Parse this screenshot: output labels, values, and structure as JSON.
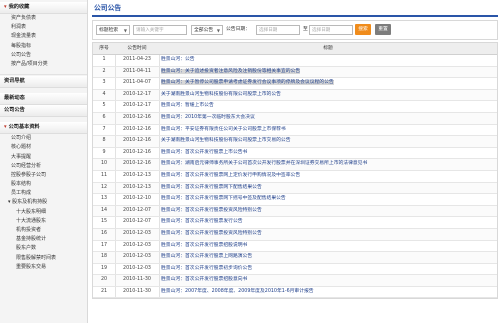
{
  "sidebar": {
    "fav_title": "我的收藏",
    "fav_items": [
      "资产负债表",
      "利润表",
      "现金流量表",
      "每股指标",
      "公司公告",
      "按产品/项目分类"
    ],
    "nav_title": "资讯导航",
    "news_title": "最新动态",
    "notice_title": "公司公告",
    "profile_title": "公司基本资料",
    "profile_items": [
      "公司介绍",
      "核心题材",
      "大事提醒",
      "公司经营分析",
      "控股参股子公司",
      "股本结构",
      "员工构成"
    ],
    "holders_title": "股东及机构持股",
    "holders_items": [
      "十大股东明细",
      "十大流通股东",
      "机构投资者",
      "基金持股统计",
      "股东户数",
      "限售股解禁时间表",
      "重要股东交易"
    ]
  },
  "header": {
    "title": "公司公告"
  },
  "search": {
    "type_select": "标题检索",
    "keyword_placeholder": "请输入关键字",
    "category_select": "全部公告",
    "date_label": "公告日期：",
    "start_placeholder": "选择日期",
    "to_label": "至",
    "end_placeholder": "选择日期",
    "search_label": "搜索",
    "reset_label": "重置"
  },
  "table": {
    "col_index": "序号",
    "col_date": "公告时间",
    "col_title": "标题",
    "rows": [
      {
        "index": "1",
        "date": "2011-04-23",
        "title": "胜景山河：公告"
      },
      {
        "index": "2",
        "date": "2011-04-11",
        "title": "胜景山河：关于追述投资者注意风险及注销股份等相关事宜的公告"
      },
      {
        "index": "3",
        "date": "2011-04-07",
        "title": "胜景山河：关于暂停公司股票申请考虑证券发行会议事项的停牌及会议议程的公告"
      },
      {
        "index": "4",
        "date": "2010-12-17",
        "title": "关于湖南胜景山河生物科技股份有限公司股票上市的公告"
      },
      {
        "index": "5",
        "date": "2010-12-17",
        "title": "胜景山河：暂缓上市公告"
      },
      {
        "index": "6",
        "date": "2010-12-16",
        "title": "胜景山河：2010年第一次临时股东大会决议"
      },
      {
        "index": "7",
        "date": "2010-12-16",
        "title": "胜景山河：平安证券有限责任公司关于公司股票上市保荐书"
      },
      {
        "index": "8",
        "date": "2010-12-16",
        "title": "关于湖南胜景山河生物科技股份有限公司股票上市交易的公告"
      },
      {
        "index": "9",
        "date": "2010-12-16",
        "title": "胜景山河：首次公开发行股票上市公告书"
      },
      {
        "index": "10",
        "date": "2010-12-16",
        "title": "胜景山河：湖南启元律师事务所关于公司首次公开发行股票并在深圳证券交易所上市的法律意见书"
      },
      {
        "index": "11",
        "date": "2010-12-13",
        "title": "胜景山河：首次公开发行股票网上定价发行申购情况及中签率公告"
      },
      {
        "index": "12",
        "date": "2010-12-13",
        "title": "胜景山河：首次公开发行股票网下配售结果公告"
      },
      {
        "index": "13",
        "date": "2010-12-10",
        "title": "胜景山河：首次公开发行股票网下摇号中签及配售结果公告"
      },
      {
        "index": "14",
        "date": "2010-12-07",
        "title": "胜景山河：首次公开发行股票投资风险特别公告"
      },
      {
        "index": "15",
        "date": "2010-12-07",
        "title": "胜景山河：首次公开发行股票发行公告"
      },
      {
        "index": "16",
        "date": "2010-12-03",
        "title": "胜景山河：首次公开发行股票投资风险特别公告"
      },
      {
        "index": "17",
        "date": "2010-12-03",
        "title": "胜景山河：首次公开发行股票招股说明书"
      },
      {
        "index": "18",
        "date": "2010-12-03",
        "title": "胜景山河：首次公开发行股票上网路演公告"
      },
      {
        "index": "19",
        "date": "2010-12-03",
        "title": "胜景山河：首次公开发行股票初步询价公告"
      },
      {
        "index": "20",
        "date": "2010-11-30",
        "title": "胜景山河：首次公开发行股票招股意向书"
      },
      {
        "index": "21",
        "date": "2010-11-30",
        "title": "胜景山河：2007年度、2008年度、2009年度及2010年1-6月审计报告"
      }
    ]
  },
  "colors": {
    "accent": "#2a55a8",
    "search_button": "#f08c1c",
    "reset_button": "#7d7d7d"
  }
}
